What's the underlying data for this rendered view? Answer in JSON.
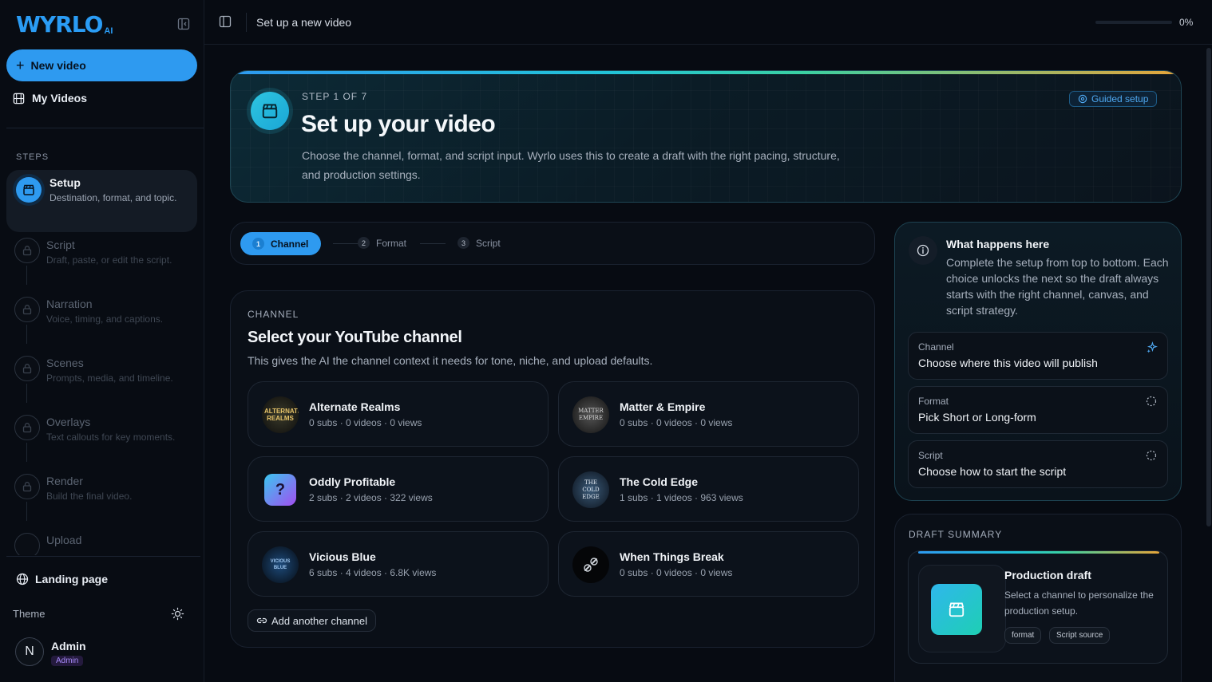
{
  "brand": {
    "name": "WYRLO",
    "suffix": "AI",
    "accent": "#2e9af0"
  },
  "sidebar": {
    "new_video_label": "New video",
    "my_videos_label": "My Videos",
    "steps_heading": "STEPS",
    "steps": [
      {
        "title": "Setup",
        "subtitle": "Destination, format, and topic.",
        "state": "active"
      },
      {
        "title": "Script",
        "subtitle": "Draft, paste, or edit the script.",
        "state": "locked"
      },
      {
        "title": "Narration",
        "subtitle": "Voice, timing, and captions.",
        "state": "locked"
      },
      {
        "title": "Scenes",
        "subtitle": "Prompts, media, and timeline.",
        "state": "locked"
      },
      {
        "title": "Overlays",
        "subtitle": "Text callouts for key moments.",
        "state": "locked"
      },
      {
        "title": "Render",
        "subtitle": "Build the final video.",
        "state": "locked"
      },
      {
        "title": "Upload",
        "subtitle": "",
        "state": "locked"
      }
    ],
    "landing_label": "Landing page",
    "theme_label": "Theme",
    "user": {
      "initial": "N",
      "name": "Admin",
      "role": "Admin"
    }
  },
  "topbar": {
    "title": "Set up a new video",
    "progress_percent": 0,
    "progress_text": "0%"
  },
  "hero": {
    "step_label": "STEP 1 OF 7",
    "title": "Set up your video",
    "description": "Choose the channel, format, and script input. Wyrlo uses this to create a draft with the right pacing, structure, and production settings.",
    "badge": "Guided setup"
  },
  "stepper": [
    {
      "num": "1",
      "label": "Channel",
      "active": true
    },
    {
      "num": "2",
      "label": "Format",
      "active": false
    },
    {
      "num": "3",
      "label": "Script",
      "active": false
    }
  ],
  "channel_section": {
    "label": "CHANNEL",
    "title": "Select your YouTube channel",
    "description": "This gives the AI the channel context it needs for tone, niche, and upload defaults.",
    "channels": [
      {
        "name": "Alternate Realms",
        "stats": "0 subs · 0 videos · 0 views",
        "avatar_text": "ALTERNATE REALMS"
      },
      {
        "name": "Matter & Empire",
        "stats": "0 subs · 0 videos · 0 views",
        "avatar_text": "MATTER EMPIRE"
      },
      {
        "name": "Oddly Profitable",
        "stats": "2 subs · 2 videos · 322 views",
        "avatar_text": "?"
      },
      {
        "name": "The Cold Edge",
        "stats": "1 subs · 1 videos · 963 views",
        "avatar_text": "THE COLD EDGE"
      },
      {
        "name": "Vicious Blue",
        "stats": "6 subs · 4 videos · 6.8K views",
        "avatar_text": "VICIOUS BLUE"
      },
      {
        "name": "When Things Break",
        "stats": "0 subs · 0 videos · 0 views",
        "avatar_text": ""
      }
    ],
    "add_label": "Add another channel"
  },
  "info": {
    "title": "What happens here",
    "description": "Complete the setup from top to bottom. Each choice unlocks the next so the draft always starts with the right channel, canvas, and script strategy.",
    "checklist": [
      {
        "label": "Channel",
        "text": "Choose where this video will publish",
        "state": "current"
      },
      {
        "label": "Format",
        "text": "Pick Short or Long-form",
        "state": "pending"
      },
      {
        "label": "Script",
        "text": "Choose how to start the script",
        "state": "pending"
      }
    ]
  },
  "draft": {
    "label": "DRAFT SUMMARY",
    "title": "Production draft",
    "description": "Select a channel to personalize the production setup.",
    "chips": [
      "format",
      "Script source"
    ]
  }
}
